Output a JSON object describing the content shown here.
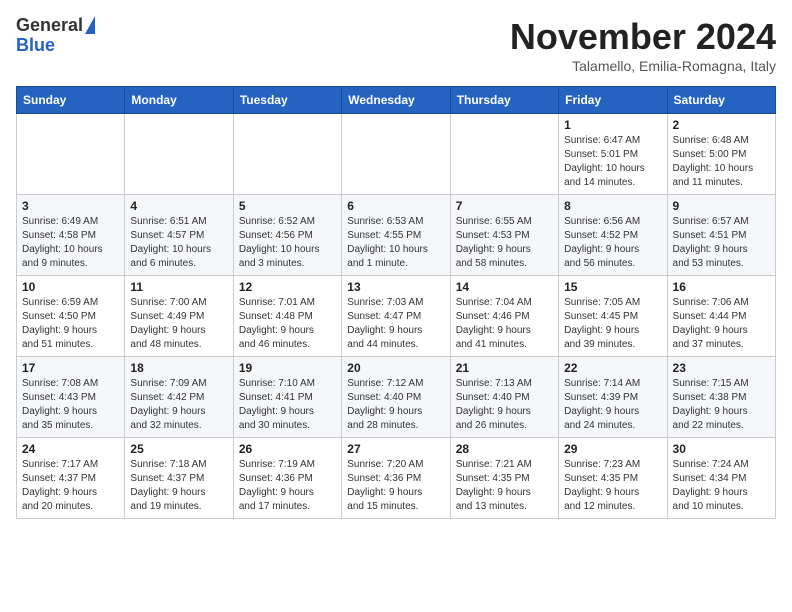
{
  "logo": {
    "general": "General",
    "blue": "Blue"
  },
  "header": {
    "month": "November 2024",
    "location": "Talamello, Emilia-Romagna, Italy"
  },
  "weekdays": [
    "Sunday",
    "Monday",
    "Tuesday",
    "Wednesday",
    "Thursday",
    "Friday",
    "Saturday"
  ],
  "weeks": [
    [
      {
        "day": "",
        "info": ""
      },
      {
        "day": "",
        "info": ""
      },
      {
        "day": "",
        "info": ""
      },
      {
        "day": "",
        "info": ""
      },
      {
        "day": "",
        "info": ""
      },
      {
        "day": "1",
        "info": "Sunrise: 6:47 AM\nSunset: 5:01 PM\nDaylight: 10 hours\nand 14 minutes."
      },
      {
        "day": "2",
        "info": "Sunrise: 6:48 AM\nSunset: 5:00 PM\nDaylight: 10 hours\nand 11 minutes."
      }
    ],
    [
      {
        "day": "3",
        "info": "Sunrise: 6:49 AM\nSunset: 4:58 PM\nDaylight: 10 hours\nand 9 minutes."
      },
      {
        "day": "4",
        "info": "Sunrise: 6:51 AM\nSunset: 4:57 PM\nDaylight: 10 hours\nand 6 minutes."
      },
      {
        "day": "5",
        "info": "Sunrise: 6:52 AM\nSunset: 4:56 PM\nDaylight: 10 hours\nand 3 minutes."
      },
      {
        "day": "6",
        "info": "Sunrise: 6:53 AM\nSunset: 4:55 PM\nDaylight: 10 hours\nand 1 minute."
      },
      {
        "day": "7",
        "info": "Sunrise: 6:55 AM\nSunset: 4:53 PM\nDaylight: 9 hours\nand 58 minutes."
      },
      {
        "day": "8",
        "info": "Sunrise: 6:56 AM\nSunset: 4:52 PM\nDaylight: 9 hours\nand 56 minutes."
      },
      {
        "day": "9",
        "info": "Sunrise: 6:57 AM\nSunset: 4:51 PM\nDaylight: 9 hours\nand 53 minutes."
      }
    ],
    [
      {
        "day": "10",
        "info": "Sunrise: 6:59 AM\nSunset: 4:50 PM\nDaylight: 9 hours\nand 51 minutes."
      },
      {
        "day": "11",
        "info": "Sunrise: 7:00 AM\nSunset: 4:49 PM\nDaylight: 9 hours\nand 48 minutes."
      },
      {
        "day": "12",
        "info": "Sunrise: 7:01 AM\nSunset: 4:48 PM\nDaylight: 9 hours\nand 46 minutes."
      },
      {
        "day": "13",
        "info": "Sunrise: 7:03 AM\nSunset: 4:47 PM\nDaylight: 9 hours\nand 44 minutes."
      },
      {
        "day": "14",
        "info": "Sunrise: 7:04 AM\nSunset: 4:46 PM\nDaylight: 9 hours\nand 41 minutes."
      },
      {
        "day": "15",
        "info": "Sunrise: 7:05 AM\nSunset: 4:45 PM\nDaylight: 9 hours\nand 39 minutes."
      },
      {
        "day": "16",
        "info": "Sunrise: 7:06 AM\nSunset: 4:44 PM\nDaylight: 9 hours\nand 37 minutes."
      }
    ],
    [
      {
        "day": "17",
        "info": "Sunrise: 7:08 AM\nSunset: 4:43 PM\nDaylight: 9 hours\nand 35 minutes."
      },
      {
        "day": "18",
        "info": "Sunrise: 7:09 AM\nSunset: 4:42 PM\nDaylight: 9 hours\nand 32 minutes."
      },
      {
        "day": "19",
        "info": "Sunrise: 7:10 AM\nSunset: 4:41 PM\nDaylight: 9 hours\nand 30 minutes."
      },
      {
        "day": "20",
        "info": "Sunrise: 7:12 AM\nSunset: 4:40 PM\nDaylight: 9 hours\nand 28 minutes."
      },
      {
        "day": "21",
        "info": "Sunrise: 7:13 AM\nSunset: 4:40 PM\nDaylight: 9 hours\nand 26 minutes."
      },
      {
        "day": "22",
        "info": "Sunrise: 7:14 AM\nSunset: 4:39 PM\nDaylight: 9 hours\nand 24 minutes."
      },
      {
        "day": "23",
        "info": "Sunrise: 7:15 AM\nSunset: 4:38 PM\nDaylight: 9 hours\nand 22 minutes."
      }
    ],
    [
      {
        "day": "24",
        "info": "Sunrise: 7:17 AM\nSunset: 4:37 PM\nDaylight: 9 hours\nand 20 minutes."
      },
      {
        "day": "25",
        "info": "Sunrise: 7:18 AM\nSunset: 4:37 PM\nDaylight: 9 hours\nand 19 minutes."
      },
      {
        "day": "26",
        "info": "Sunrise: 7:19 AM\nSunset: 4:36 PM\nDaylight: 9 hours\nand 17 minutes."
      },
      {
        "day": "27",
        "info": "Sunrise: 7:20 AM\nSunset: 4:36 PM\nDaylight: 9 hours\nand 15 minutes."
      },
      {
        "day": "28",
        "info": "Sunrise: 7:21 AM\nSunset: 4:35 PM\nDaylight: 9 hours\nand 13 minutes."
      },
      {
        "day": "29",
        "info": "Sunrise: 7:23 AM\nSunset: 4:35 PM\nDaylight: 9 hours\nand 12 minutes."
      },
      {
        "day": "30",
        "info": "Sunrise: 7:24 AM\nSunset: 4:34 PM\nDaylight: 9 hours\nand 10 minutes."
      }
    ]
  ]
}
